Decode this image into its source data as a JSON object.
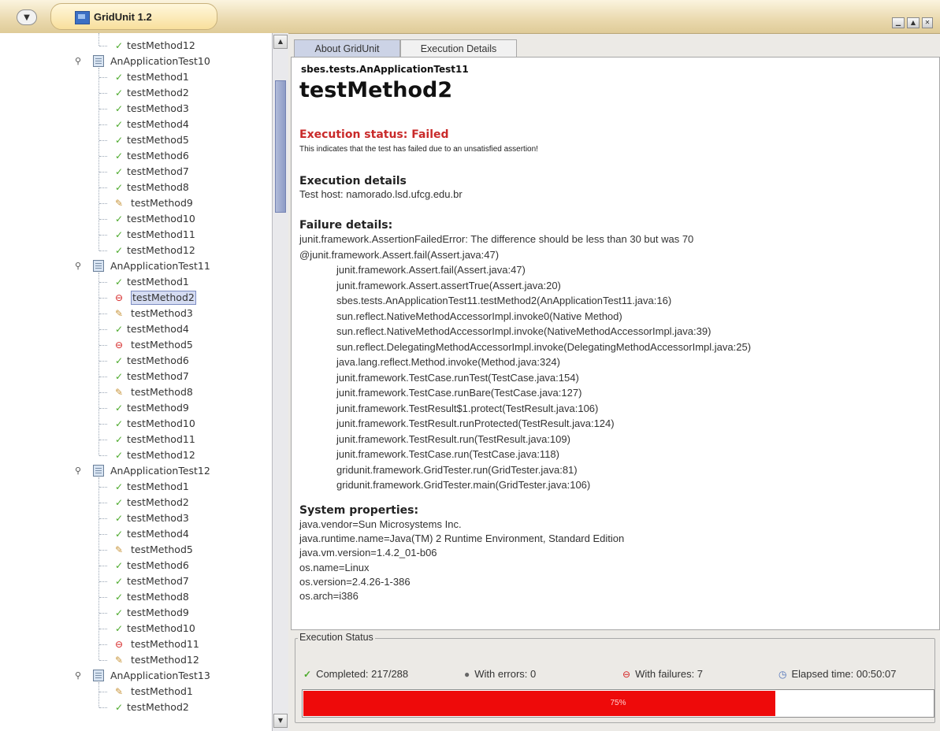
{
  "window": {
    "title": "GridUnit 1.2",
    "controls": [
      "minimize",
      "maximize",
      "close"
    ]
  },
  "colors": {
    "progress_fill": "#ee0a0a",
    "failed_status": "#c92a2a",
    "selected_row_bg": "#d5dcf2",
    "active_tab_bg": "#ccd3e6"
  },
  "tree": {
    "rows": [
      {
        "kind": "method",
        "label": "testMethod12",
        "status": "pass"
      },
      {
        "kind": "suite",
        "label": "AnApplicationTest10"
      },
      {
        "kind": "method",
        "label": "testMethod1",
        "status": "pass"
      },
      {
        "kind": "method",
        "label": "testMethod2",
        "status": "pass"
      },
      {
        "kind": "method",
        "label": "testMethod3",
        "status": "pass"
      },
      {
        "kind": "method",
        "label": "testMethod4",
        "status": "pass"
      },
      {
        "kind": "method",
        "label": "testMethod5",
        "status": "pass"
      },
      {
        "kind": "method",
        "label": "testMethod6",
        "status": "pass"
      },
      {
        "kind": "method",
        "label": "testMethod7",
        "status": "pass"
      },
      {
        "kind": "method",
        "label": "testMethod8",
        "status": "pass"
      },
      {
        "kind": "method",
        "label": "testMethod9",
        "status": "error"
      },
      {
        "kind": "method",
        "label": "testMethod10",
        "status": "pass"
      },
      {
        "kind": "method",
        "label": "testMethod11",
        "status": "pass"
      },
      {
        "kind": "method",
        "label": "testMethod12",
        "status": "pass"
      },
      {
        "kind": "suite",
        "label": "AnApplicationTest11"
      },
      {
        "kind": "method",
        "label": "testMethod1",
        "status": "pass"
      },
      {
        "kind": "method",
        "label": "testMethod2",
        "status": "fail",
        "selected": true
      },
      {
        "kind": "method",
        "label": "testMethod3",
        "status": "error"
      },
      {
        "kind": "method",
        "label": "testMethod4",
        "status": "pass"
      },
      {
        "kind": "method",
        "label": "testMethod5",
        "status": "fail"
      },
      {
        "kind": "method",
        "label": "testMethod6",
        "status": "pass"
      },
      {
        "kind": "method",
        "label": "testMethod7",
        "status": "pass"
      },
      {
        "kind": "method",
        "label": "testMethod8",
        "status": "error"
      },
      {
        "kind": "method",
        "label": "testMethod9",
        "status": "pass"
      },
      {
        "kind": "method",
        "label": "testMethod10",
        "status": "pass"
      },
      {
        "kind": "method",
        "label": "testMethod11",
        "status": "pass"
      },
      {
        "kind": "method",
        "label": "testMethod12",
        "status": "pass"
      },
      {
        "kind": "suite",
        "label": "AnApplicationTest12"
      },
      {
        "kind": "method",
        "label": "testMethod1",
        "status": "pass"
      },
      {
        "kind": "method",
        "label": "testMethod2",
        "status": "pass"
      },
      {
        "kind": "method",
        "label": "testMethod3",
        "status": "pass"
      },
      {
        "kind": "method",
        "label": "testMethod4",
        "status": "pass"
      },
      {
        "kind": "method",
        "label": "testMethod5",
        "status": "error"
      },
      {
        "kind": "method",
        "label": "testMethod6",
        "status": "pass"
      },
      {
        "kind": "method",
        "label": "testMethod7",
        "status": "pass"
      },
      {
        "kind": "method",
        "label": "testMethod8",
        "status": "pass"
      },
      {
        "kind": "method",
        "label": "testMethod9",
        "status": "pass"
      },
      {
        "kind": "method",
        "label": "testMethod10",
        "status": "pass"
      },
      {
        "kind": "method",
        "label": "testMethod11",
        "status": "fail"
      },
      {
        "kind": "method",
        "label": "testMethod12",
        "status": "error"
      },
      {
        "kind": "suite",
        "label": "AnApplicationTest13"
      },
      {
        "kind": "method",
        "label": "testMethod1",
        "status": "error"
      },
      {
        "kind": "method",
        "label": "testMethod2",
        "status": "pass"
      }
    ]
  },
  "tabs": [
    {
      "label": "About GridUnit",
      "active": true
    },
    {
      "label": "Execution Details",
      "active": false
    }
  ],
  "details": {
    "class_name": "sbes.tests.AnApplicationTest11",
    "method_name": "testMethod2",
    "status_title": "Execution status: Failed",
    "status_description": "This indicates that the test has failed due to an unsatisfied assertion!",
    "execution_details_heading": "Execution details",
    "test_host": "Test host: namorado.lsd.ufcg.edu.br",
    "failure_heading": "Failure details:",
    "failure_message": "junit.framework.AssertionFailedError: The difference should be less than 30 but was 70",
    "failure_first": "@junit.framework.Assert.fail(Assert.java:47)",
    "stack_trace": [
      "junit.framework.Assert.fail(Assert.java:47)",
      "junit.framework.Assert.assertTrue(Assert.java:20)",
      "sbes.tests.AnApplicationTest11.testMethod2(AnApplicationTest11.java:16)",
      "sun.reflect.NativeMethodAccessorImpl.invoke0(Native Method)",
      "sun.reflect.NativeMethodAccessorImpl.invoke(NativeMethodAccessorImpl.java:39)",
      "sun.reflect.DelegatingMethodAccessorImpl.invoke(DelegatingMethodAccessorImpl.java:25)",
      "java.lang.reflect.Method.invoke(Method.java:324)",
      "junit.framework.TestCase.runTest(TestCase.java:154)",
      "junit.framework.TestCase.runBare(TestCase.java:127)",
      "junit.framework.TestResult$1.protect(TestResult.java:106)",
      "junit.framework.TestResult.runProtected(TestResult.java:124)",
      "junit.framework.TestResult.run(TestResult.java:109)",
      "junit.framework.TestCase.run(TestCase.java:118)",
      "gridunit.framework.GridTester.run(GridTester.java:81)",
      "gridunit.framework.GridTester.main(GridTester.java:106)"
    ],
    "system_heading": "System properties:",
    "system_properties": [
      "java.vendor=Sun Microsystems Inc.",
      "java.runtime.name=Java(TM) 2 Runtime Environment, Standard Edition",
      "java.vm.version=1.4.2_01-b06",
      "os.name=Linux",
      "os.version=2.4.26-1-386",
      "os.arch=i386"
    ]
  },
  "execution_status": {
    "title": "Execution Status",
    "completed": "Completed: 217/288",
    "with_errors": "With errors: 0",
    "with_failures": "With failures: 7",
    "elapsed": "Elapsed time: 00:50:07",
    "progress_text": "75%",
    "progress_fraction": 0.75
  }
}
